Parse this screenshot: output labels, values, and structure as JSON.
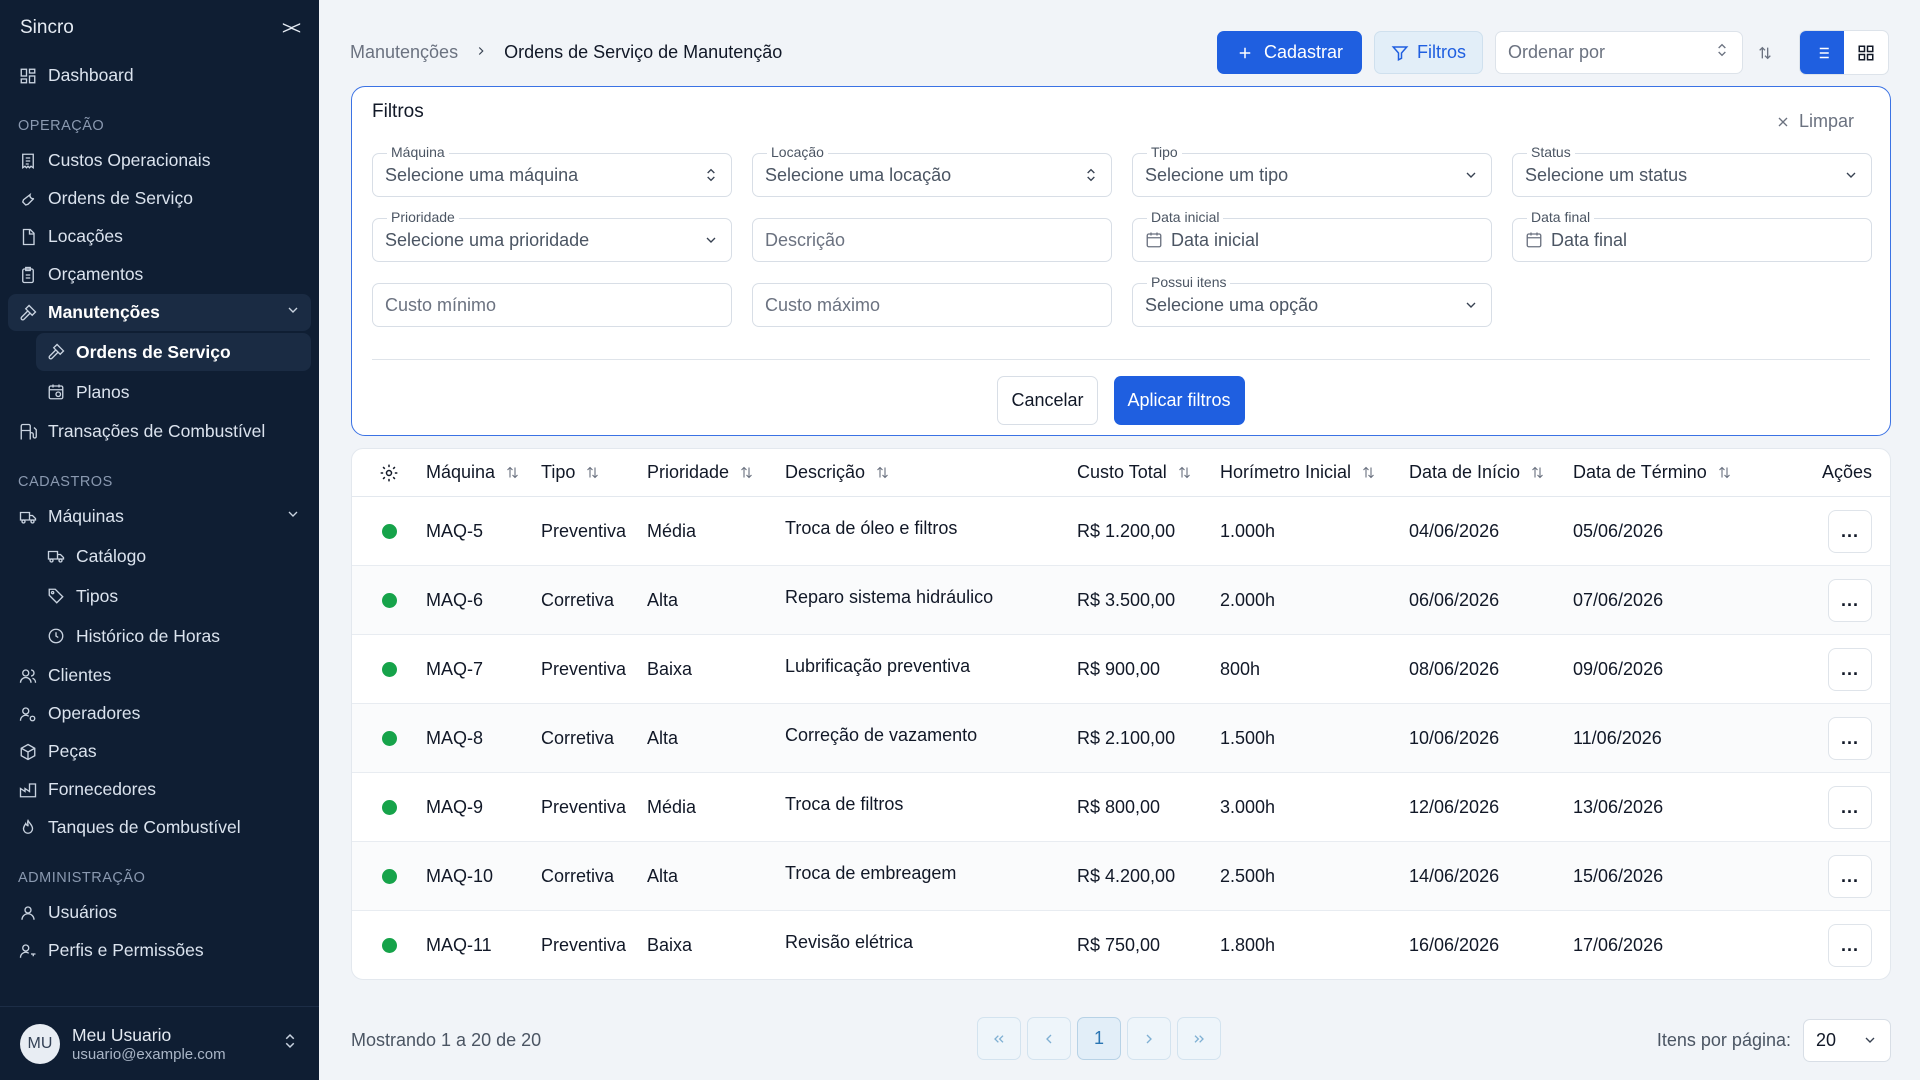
{
  "sidebar": {
    "brand": "Sincro",
    "dashboard": "Dashboard",
    "sections": {
      "operacao": "OPERAÇÃO",
      "cadastros": "CADASTROS",
      "administracao": "ADMINISTRAÇÃO"
    },
    "operacao_items": [
      "Custos Operacionais",
      "Ordens de Serviço",
      "Locações",
      "Orçamentos"
    ],
    "manutencoes": {
      "label": "Manutenções",
      "children": [
        "Ordens de Serviço",
        "Planos"
      ]
    },
    "transacoes": "Transações de Combustível",
    "maquinas": {
      "label": "Máquinas",
      "children": [
        "Catálogo",
        "Tipos",
        "Histórico de Horas"
      ]
    },
    "cadastros_items": [
      "Clientes",
      "Operadores",
      "Peças",
      "Fornecedores",
      "Tanques de Combustível"
    ],
    "admin_items": [
      "Usuários",
      "Perfis e Permissões"
    ],
    "user": {
      "initials": "MU",
      "name": "Meu Usuario",
      "email": "usuario@example.com"
    }
  },
  "header": {
    "breadcrumb_parent": "Manutenções",
    "breadcrumb_current": "Ordens de Serviço de Manutenção",
    "add_label": "Cadastrar",
    "filter_label": "Filtros",
    "sort_placeholder": "Ordenar por"
  },
  "filters": {
    "title": "Filtros",
    "clear_label": "Limpar",
    "machine": {
      "label": "Máquina",
      "placeholder": "Selecione uma máquina"
    },
    "location": {
      "label": "Locação",
      "placeholder": "Selecione uma locação"
    },
    "type": {
      "label": "Tipo",
      "placeholder": "Selecione um tipo"
    },
    "status": {
      "label": "Status",
      "placeholder": "Selecione um status"
    },
    "priority": {
      "label": "Prioridade",
      "placeholder": "Selecione uma prioridade"
    },
    "description": {
      "placeholder": "Descrição"
    },
    "start_date": {
      "label": "Data inicial",
      "placeholder": "Data inicial"
    },
    "end_date": {
      "label": "Data final",
      "placeholder": "Data final"
    },
    "min_cost": {
      "placeholder": "Custo mínimo"
    },
    "max_cost": {
      "placeholder": "Custo máximo"
    },
    "has_items": {
      "label": "Possui itens",
      "placeholder": "Selecione uma opção"
    },
    "cancel_label": "Cancelar",
    "apply_label": "Aplicar filtros"
  },
  "table": {
    "columns": [
      "Máquina",
      "Tipo",
      "Prioridade",
      "Descrição",
      "Custo Total",
      "Horímetro Inicial",
      "Data de Início",
      "Data de Término",
      "Ações"
    ],
    "rows": [
      {
        "machine": "MAQ-5",
        "type": "Preventiva",
        "priority": "Média",
        "description": "Troca de óleo e filtros",
        "cost": "R$ 1.200,00",
        "hours": "1.000h",
        "start": "04/06/2026",
        "end": "05/06/2026"
      },
      {
        "machine": "MAQ-6",
        "type": "Corretiva",
        "priority": "Alta",
        "description": "Reparo sistema hidráulico",
        "cost": "R$ 3.500,00",
        "hours": "2.000h",
        "start": "06/06/2026",
        "end": "07/06/2026"
      },
      {
        "machine": "MAQ-7",
        "type": "Preventiva",
        "priority": "Baixa",
        "description": "Lubrificação preventiva",
        "cost": "R$ 900,00",
        "hours": "800h",
        "start": "08/06/2026",
        "end": "09/06/2026"
      },
      {
        "machine": "MAQ-8",
        "type": "Corretiva",
        "priority": "Alta",
        "description": "Correção de vazamento",
        "cost": "R$ 2.100,00",
        "hours": "1.500h",
        "start": "10/06/2026",
        "end": "11/06/2026"
      },
      {
        "machine": "MAQ-9",
        "type": "Preventiva",
        "priority": "Média",
        "description": "Troca de filtros",
        "cost": "R$ 800,00",
        "hours": "3.000h",
        "start": "12/06/2026",
        "end": "13/06/2026"
      },
      {
        "machine": "MAQ-10",
        "type": "Corretiva",
        "priority": "Alta",
        "description": "Troca de embreagem",
        "cost": "R$ 4.200,00",
        "hours": "2.500h",
        "start": "14/06/2026",
        "end": "15/06/2026"
      },
      {
        "machine": "MAQ-11",
        "type": "Preventiva",
        "priority": "Baixa",
        "description": "Revisão elétrica",
        "cost": "R$ 750,00",
        "hours": "1.800h",
        "start": "16/06/2026",
        "end": "17/06/2026"
      }
    ],
    "actions_label": "..."
  },
  "pagination": {
    "showing": "Mostrando 1 a 20 de 20",
    "current_page": "1",
    "per_page_label": "Itens por página:",
    "per_page_value": "20"
  },
  "colors": {
    "primary": "#1f5fe0",
    "sidebar_bg": "#0f1e33",
    "status_active": "#16a34a"
  }
}
